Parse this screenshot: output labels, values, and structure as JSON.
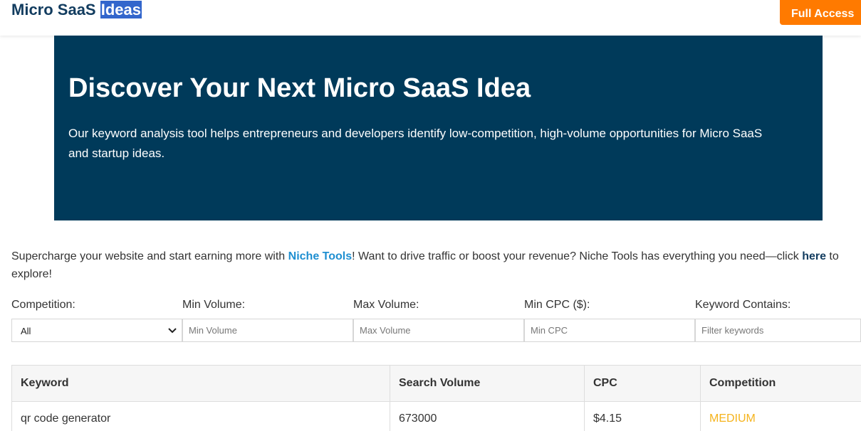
{
  "header": {
    "brand_part1": "Micro SaaS ",
    "brand_part2": "Ideas",
    "cta_label": "Full Access"
  },
  "hero": {
    "title": "Discover Your Next Micro SaaS Idea",
    "description": "Our keyword analysis tool helps entrepreneurs and developers identify low-competition, high-volume opportunities for Micro SaaS and startup ideas."
  },
  "promo": {
    "text_before": "Supercharge your website and start earning more with ",
    "niche_link": "Niche Tools",
    "text_middle": "! Want to drive traffic or boost your revenue? Niche Tools has everything you need—click ",
    "here_link": "here",
    "text_after": " to explore!"
  },
  "filters": {
    "competition_label": "Competition:",
    "competition_value": "All",
    "min_volume_label": "Min Volume:",
    "min_volume_placeholder": "Min Volume",
    "max_volume_label": "Max Volume:",
    "max_volume_placeholder": "Max Volume",
    "min_cpc_label": "Min CPC ($):",
    "min_cpc_placeholder": "Min CPC",
    "keyword_label": "Keyword Contains:",
    "keyword_placeholder": "Filter keywords"
  },
  "table": {
    "headers": [
      "Keyword",
      "Search Volume",
      "CPC",
      "Competition"
    ],
    "rows": [
      {
        "keyword": "qr code generator",
        "volume": "673000",
        "cpc": "$4.15",
        "competition": "MEDIUM"
      }
    ]
  },
  "colors": {
    "hero_bg": "#003a5a",
    "cta_bg": "#ff7a00",
    "link_blue": "#1f8fd1",
    "medium_competition": "#f5b31c"
  },
  "icons": {
    "select_chevron": "chevron-down-icon"
  }
}
